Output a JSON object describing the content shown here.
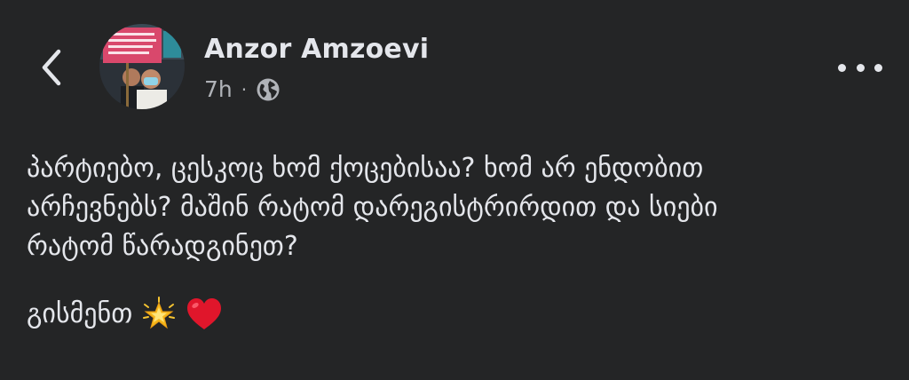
{
  "post": {
    "author": "Anzor Amzoevi",
    "time": "7h",
    "separator": "·",
    "audience_icon": "globe-icon",
    "lines": [
      "პარტიებო, ცესკოც ხომ ქოცებისაა? ხომ არ ენდობით",
      "არჩევნებს? მაშინ რატომ დარეგისტრირდით და სიები",
      "რატომ წარადგინეთ?"
    ],
    "signoff": "გისმენთ",
    "emojis": [
      "glowing-star-icon",
      "red-heart-icon"
    ]
  },
  "header": {
    "back_icon": "back-chevron-icon",
    "more_icon": "more-options-icon"
  },
  "colors": {
    "background": "#242526",
    "text": "#e4e6eb",
    "secondary": "#b0b3b8",
    "heart": "#e0162b"
  }
}
